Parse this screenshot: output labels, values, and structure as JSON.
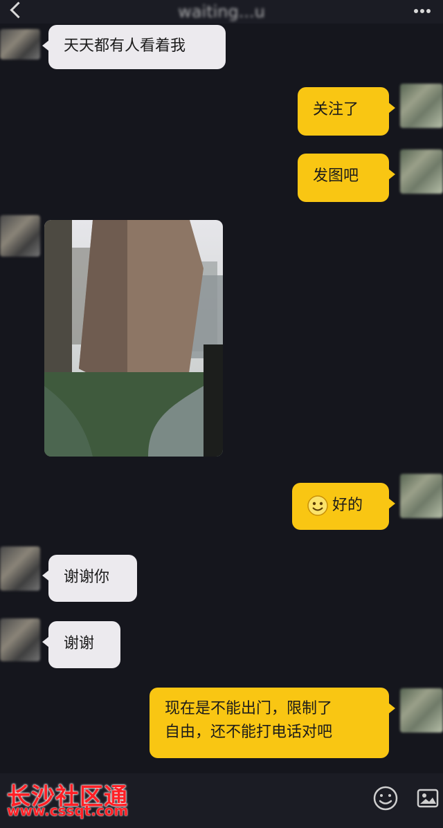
{
  "header": {
    "title": "waiting...u",
    "back_icon": "chevron-left-icon",
    "more_icon": "more-icon"
  },
  "messages": [
    {
      "side": "left",
      "text": "天天都有人看着我"
    },
    {
      "side": "right",
      "text": "关注了"
    },
    {
      "side": "right",
      "text": "发图吧"
    },
    {
      "side": "left",
      "type": "image",
      "alt": "residential building view"
    },
    {
      "side": "right",
      "emoji": "smile-icon",
      "text": "好的"
    },
    {
      "side": "left",
      "text": "谢谢你"
    },
    {
      "side": "left",
      "text": "谢谢"
    },
    {
      "side": "right",
      "line1": "现在是不能出门，限制了",
      "line2": "自由，还不能打电话对吧"
    }
  ],
  "watermark": {
    "title": "长沙社区通",
    "url": "www.cssqt.com"
  },
  "bottom": {
    "emoji_icon": "emoji-icon",
    "image_icon": "image-icon"
  },
  "colors": {
    "background": "#15161d",
    "left_bubble": "#eceaee",
    "right_bubble": "#f9c613",
    "watermark": "#ff2026"
  }
}
